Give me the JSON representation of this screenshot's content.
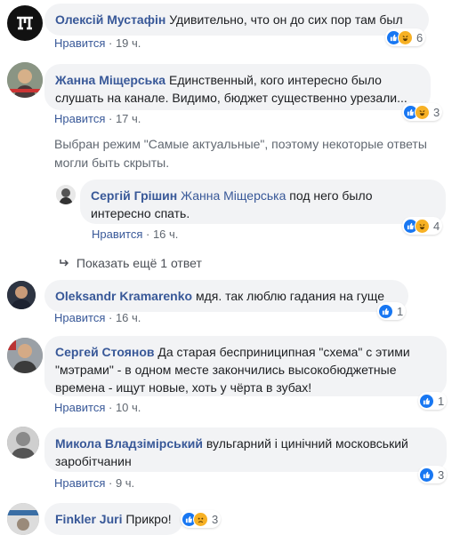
{
  "comments": [
    {
      "name": "Олексій Мустафін",
      "text": "Удивительно, что он до сих пор там был",
      "like": "Нравится",
      "time": "19 ч.",
      "count": "6"
    },
    {
      "name": "Жанна Міщерська",
      "text": "Единственный, кого интересно было слушать на канале. Видимо, бюджет существенно урезали...",
      "like": "Нравится",
      "time": "17 ч.",
      "count": "3"
    },
    {
      "name": "Сергій Грішин",
      "mention": "Жанна Міщерська",
      "text": "под него было интересно спать.",
      "like": "Нравится",
      "time": "16 ч.",
      "count": "4"
    },
    {
      "name": "Oleksandr Kramarenko",
      "text": "мдя. так люблю гадания на гуще",
      "like": "Нравится",
      "time": "16 ч.",
      "count": "1"
    },
    {
      "name": "Сергей Стоянов",
      "text": "Да старая бесприниципная \"схема\" с этими \"мэтрами\" - в одном месте закончились высокобюджетные времена - ищут новые, хоть у чёрта в зубах!",
      "like": "Нравится",
      "time": "10 ч.",
      "count": "1"
    },
    {
      "name": "Микола Владзімірський",
      "text": "вульгарний і цинічний московський заробітчанин",
      "like": "Нравится",
      "time": "9 ч.",
      "count": "3"
    },
    {
      "name": "Finkler Juri",
      "text": "Прикро!",
      "count": "3"
    }
  ],
  "notice": "Выбран режим \"Самые актуальные\", поэтому некоторые ответы могли быть скрыты.",
  "show_more": "Показать ещё 1 ответ",
  "colors": {
    "link": "#385898",
    "bubble": "#f2f3f5",
    "meta": "#606770",
    "like_blue": "#1877f2",
    "haha_yellow": "#f7b125"
  }
}
